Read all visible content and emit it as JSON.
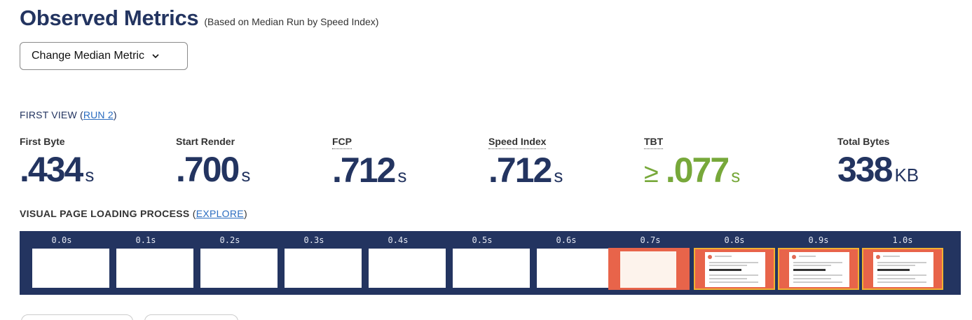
{
  "header": {
    "title": "Observed Metrics",
    "subtitle": "(Based on Median Run by Speed Index)"
  },
  "median_button": {
    "label": "Change Median Metric",
    "icon": "chevron-down-icon"
  },
  "first_view": {
    "label": "FIRST VIEW (",
    "run_link": "RUN 2",
    "close": ")"
  },
  "metrics": [
    {
      "label": "First Byte",
      "value": ".434",
      "unit": "s"
    },
    {
      "label": "Start Render",
      "value": ".700",
      "unit": "s"
    },
    {
      "label": "FCP",
      "value": ".712",
      "unit": "s"
    },
    {
      "label": "Speed Index",
      "value": ".712",
      "unit": "s"
    },
    {
      "label": "TBT",
      "prefix": "≥",
      "value": ".077",
      "unit": "s",
      "color": "#77a83a"
    },
    {
      "label": "Total Bytes",
      "value": "338",
      "unit": "KB"
    }
  ],
  "visual_loading": {
    "label": "VISUAL PAGE LOADING PROCESS",
    "open": "(",
    "explore_link": "EXPLORE",
    "close": ")"
  },
  "filmstrip": {
    "background": "#233460",
    "frames": [
      {
        "time": "0.0s",
        "state": "blank"
      },
      {
        "time": "0.1s",
        "state": "blank"
      },
      {
        "time": "0.2s",
        "state": "blank"
      },
      {
        "time": "0.3s",
        "state": "blank"
      },
      {
        "time": "0.4s",
        "state": "blank"
      },
      {
        "time": "0.5s",
        "state": "blank"
      },
      {
        "time": "0.6s",
        "state": "blank"
      },
      {
        "time": "0.7s",
        "state": "render-start"
      },
      {
        "time": "0.8s",
        "state": "rendered"
      },
      {
        "time": "0.9s",
        "state": "rendered"
      },
      {
        "time": "1.0s",
        "state": "rendered"
      }
    ]
  },
  "colors": {
    "navy": "#233460",
    "green": "#77a83a",
    "link": "#2a6cc0",
    "frame_changed_bg": "#e8644a",
    "frame_changed_border": "#f2b131"
  }
}
